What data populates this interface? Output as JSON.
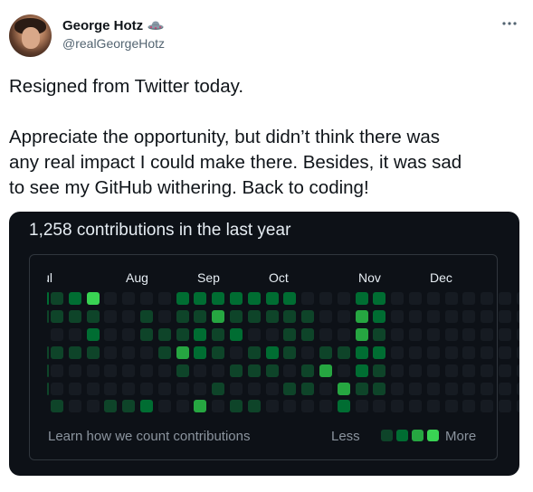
{
  "author": {
    "display_name": "George Hotz",
    "handle": "@realGeorgeHotz",
    "badge_icon": "flying-saucer-icon"
  },
  "tweet": {
    "line1": "Resigned from Twitter today.",
    "line2": "Appreciate the opportunity, but didn’t think there was",
    "line3": "any real impact I could make there. Besides, it was sad",
    "line4": "to see my GitHub withering. Back to coding!"
  },
  "more_icon": "ellipsis-icon",
  "media": {
    "title": "1,258 contributions in the last year",
    "months": [
      "Jul",
      "Aug",
      "Sep",
      "Oct",
      "Nov",
      "Dec"
    ],
    "learn_link": "Learn how we count contributions",
    "legend_less": "Less",
    "legend_more": "More",
    "colors": {
      "background": "#0d1117",
      "level0": "#161b22",
      "level1": "#0e4429",
      "level2": "#006d32",
      "level3": "#26a641",
      "level4": "#39d353"
    },
    "heatmap": [
      [
        1,
        2,
        4,
        0,
        0,
        0,
        0,
        2,
        2,
        2,
        2,
        2,
        2,
        2,
        0,
        0,
        0,
        2,
        2,
        0,
        0,
        0,
        0,
        0,
        0,
        0,
        0
      ],
      [
        1,
        1,
        1,
        0,
        0,
        1,
        0,
        1,
        1,
        3,
        1,
        1,
        1,
        1,
        1,
        0,
        0,
        3,
        2,
        0,
        0,
        0,
        0,
        0,
        0,
        0,
        0
      ],
      [
        0,
        0,
        2,
        0,
        0,
        1,
        1,
        1,
        2,
        1,
        2,
        0,
        0,
        1,
        1,
        0,
        0,
        3,
        1,
        0,
        0,
        0,
        0,
        0,
        0,
        0,
        0
      ],
      [
        1,
        1,
        1,
        0,
        0,
        0,
        1,
        3,
        2,
        1,
        0,
        1,
        2,
        1,
        0,
        1,
        1,
        2,
        2,
        0,
        0,
        0,
        0,
        0,
        0,
        0,
        0
      ],
      [
        0,
        0,
        0,
        0,
        0,
        0,
        0,
        1,
        0,
        0,
        1,
        1,
        1,
        0,
        1,
        3,
        0,
        2,
        1,
        0,
        0,
        0,
        0,
        0,
        0,
        0,
        0
      ],
      [
        0,
        0,
        0,
        0,
        0,
        0,
        0,
        0,
        0,
        1,
        0,
        0,
        0,
        1,
        1,
        0,
        3,
        1,
        1,
        0,
        0,
        0,
        0,
        0,
        0,
        0,
        0
      ],
      [
        1,
        0,
        0,
        1,
        1,
        2,
        0,
        0,
        3,
        0,
        1,
        1,
        0,
        0,
        0,
        0,
        2,
        0,
        0,
        0,
        0,
        0,
        0,
        0,
        0,
        0,
        0
      ]
    ]
  }
}
